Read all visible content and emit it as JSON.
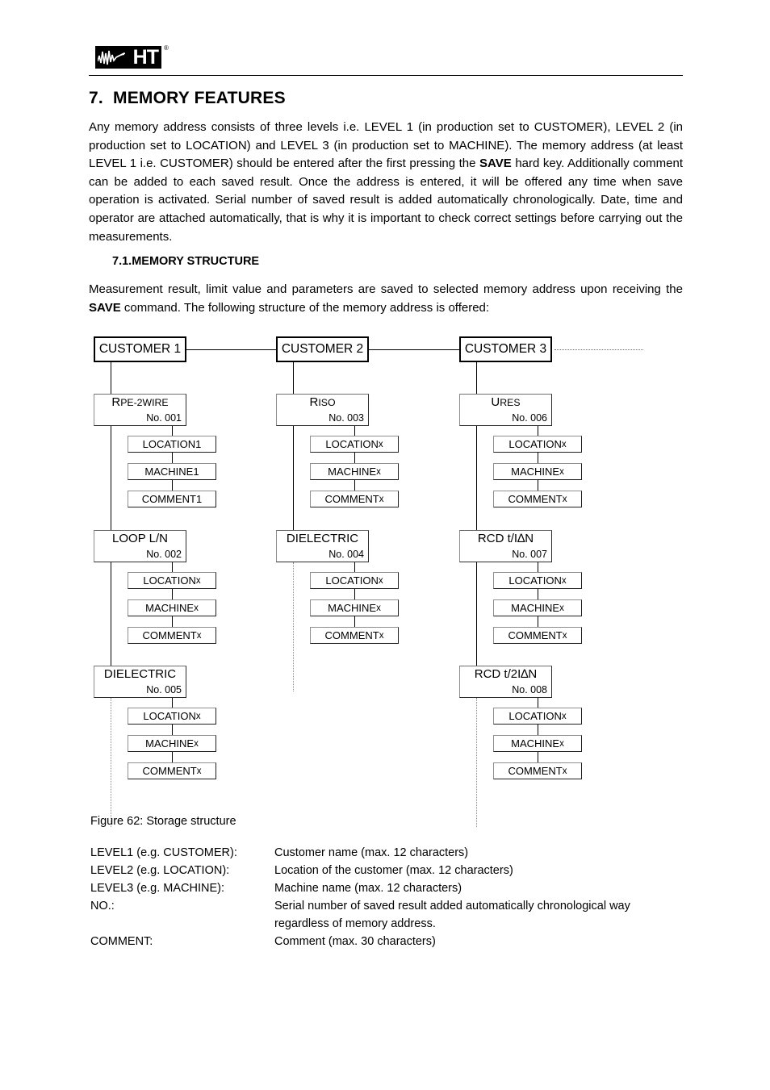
{
  "header": {
    "logo_text": "HT",
    "logo_registered": "®",
    "logo_icon": "waveform-logo"
  },
  "section": {
    "number": "7.",
    "title": "MEMORY FEATURES",
    "paragraph": "Any memory address consists of three levels i.e. LEVEL 1 (in production set to CUSTOMER), LEVEL 2 (in production set to LOCATION) and LEVEL 3 (in production set to MACHINE). The memory address (at least LEVEL 1 i.e. CUSTOMER) should be entered after the first pressing the ",
    "paragraph_bold": "SAVE",
    "paragraph_rest": " hard key. Additionally comment can be added to each saved result. Once the address is entered, it will be offered any time when save operation is activated. Serial number of saved result is added automatically chronologically. Date, time and operator are attached automatically, that is why it is important to check correct settings before carrying out the measurements."
  },
  "subsection": {
    "number": "7.1.",
    "title": "MEMORY STRUCTURE",
    "paragraph_start": "Measurement result, limit value and parameters are saved to selected memory address upon receiving the ",
    "paragraph_bold": "SAVE",
    "paragraph_end": " command. The following structure of the memory address is offered:"
  },
  "diagram": {
    "customers": [
      {
        "label": "CUSTOMER 1"
      },
      {
        "label": "CUSTOMER 2"
      },
      {
        "label": "CUSTOMER 3"
      }
    ],
    "columns": [
      {
        "customer": "CUSTOMER 1",
        "measurements": [
          {
            "title_first": "R",
            "title_rest": "PE-2WIRE",
            "smallcaps": true,
            "no": "No. 001",
            "sub": [
              "LOCATION 1",
              "MACHINE 1",
              "COMMENT 1"
            ]
          },
          {
            "title_first": "LOOP L/N",
            "title_rest": "",
            "smallcaps": false,
            "no": "No. 002",
            "sub": [
              "LOCATION x",
              "MACHINE x",
              "COMMENT x"
            ]
          },
          {
            "title_first": "DIELECTRIC",
            "title_rest": "",
            "smallcaps": false,
            "no": "No. 005",
            "sub": [
              "LOCATION x",
              "MACHINE x",
              "COMMENT x"
            ]
          }
        ]
      },
      {
        "customer": "CUSTOMER 2",
        "measurements": [
          {
            "title_first": "R",
            "title_rest": "ISO",
            "smallcaps": true,
            "no": "No. 003",
            "sub": [
              "LOCATION x",
              "MACHINE x",
              "COMMENT x"
            ]
          },
          {
            "title_first": "DIELECTRIC",
            "title_rest": "",
            "smallcaps": false,
            "no": "No. 004",
            "sub": [
              "LOCATION x",
              "MACHINE x",
              "COMMENT x"
            ]
          }
        ]
      },
      {
        "customer": "CUSTOMER 3",
        "measurements": [
          {
            "title_first": "U",
            "title_rest": "RES",
            "smallcaps": true,
            "no": "No. 006",
            "sub": [
              "LOCATION x",
              "MACHINE x",
              "COMMENT x"
            ]
          },
          {
            "title_first": "RCD t/I∆N",
            "title_rest": "",
            "smallcaps": false,
            "no": "No. 007",
            "sub": [
              "LOCATION x",
              "MACHINE x",
              "COMMENT x"
            ]
          },
          {
            "title_first": "RCD t/2I∆N",
            "title_rest": "",
            "smallcaps": false,
            "no": "No. 008",
            "sub": [
              "LOCATION x",
              "MACHINE x",
              "COMMENT x"
            ]
          }
        ]
      }
    ]
  },
  "figure": {
    "caption": "Figure 62: Storage structure"
  },
  "legend": {
    "rows": [
      {
        "term": "LEVEL1 (e.g. CUSTOMER):",
        "desc": "Customer name (max. 12 characters)",
        "cont": ""
      },
      {
        "term": "LEVEL2 (e.g. LOCATION):",
        "desc": "Location of the customer (max. 12 characters)",
        "cont": ""
      },
      {
        "term": "LEVEL3 (e.g. MACHINE):",
        "desc": "Machine name (max. 12 characters)",
        "cont": ""
      },
      {
        "term": "NO.:",
        "desc": "Serial number of saved result added automatically chronological way",
        "cont": "regardless of memory address."
      },
      {
        "term": "COMMENT:",
        "desc": "Comment (max. 30 characters)",
        "cont": ""
      }
    ]
  }
}
